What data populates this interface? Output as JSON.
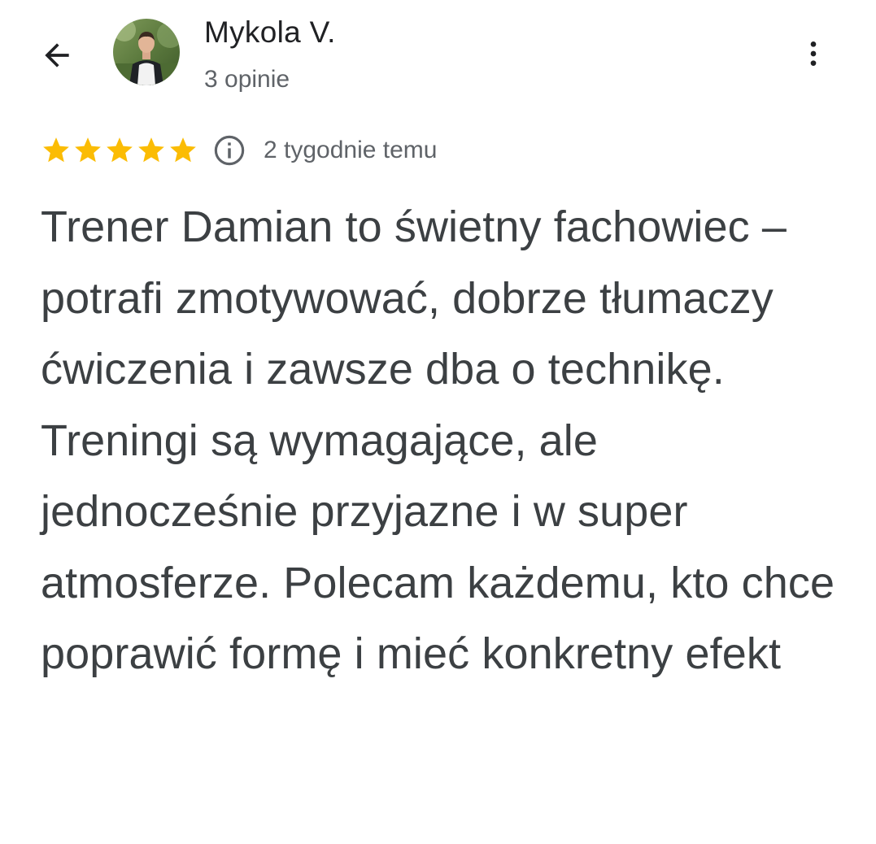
{
  "header": {
    "back_icon": "arrow-back-icon",
    "user_name": "Mykola V.",
    "review_count": "3 opinie",
    "more_icon": "more-vert-icon"
  },
  "review": {
    "rating": 5,
    "rating_max": 5,
    "star_color": "#FBBC04",
    "info_icon": "info-icon",
    "date": "2 tygodnie temu",
    "text": "Trener Damian to świetny fachowiec – potrafi zmotywować, dobrze tłumaczy ćwiczenia i zawsze dba o technikę. Treningi są wymagające, ale jednocześnie przyjazne i w super atmosferze. Polecam każdemu, kto chce poprawić formę i mieć konkretny efekt"
  }
}
